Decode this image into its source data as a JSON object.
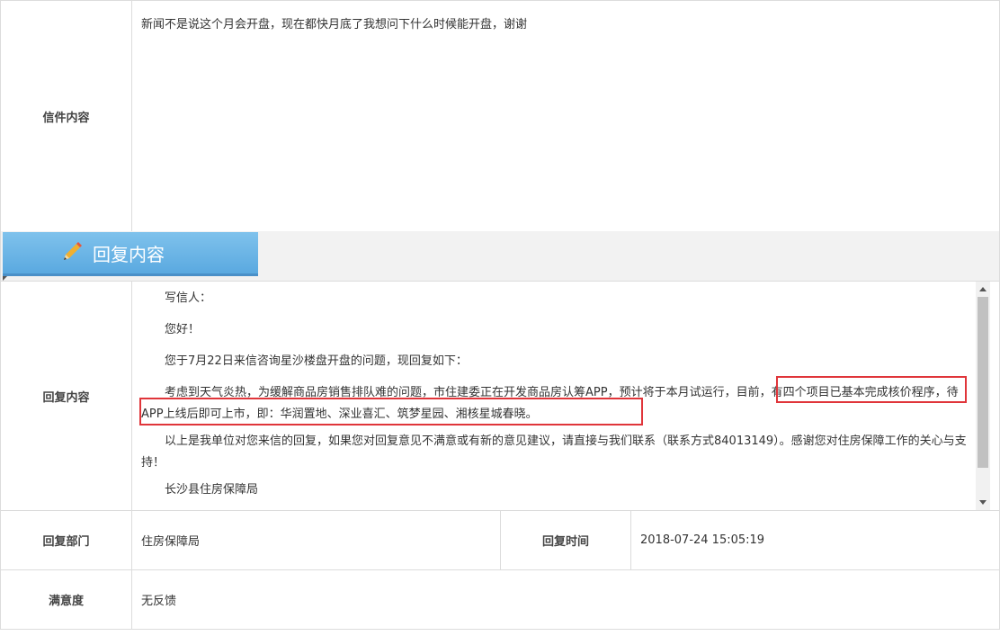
{
  "letter": {
    "label": "信件内容",
    "content": "新闻不是说这个月会开盘，现在都快月底了我想问下什么时候能开盘，谢谢"
  },
  "banner": {
    "title": "回复内容",
    "icon": "pencil-icon"
  },
  "reply": {
    "label": "回复内容",
    "paragraphs": [
      "写信人：",
      "您好！",
      "您于7月22日来信咨询星沙楼盘开盘的问题，现回复如下：",
      "考虑到天气炎热，为缓解商品房销售排队难的问题，市住建委正在开发商品房认筹APP，预计将于本月试运行，目前，有四个项目已基本完成核价程序，待APP上线后即可上市，即：华润置地、深业喜汇、筑梦星园、湘核星城春晓。",
      "以上是我单位对您来信的回复，如果您对回复意见不满意或有新的意见建议，请直接与我们联系（联系方式84013149）。感谢您对住房保障工作的关心与支持！",
      "长沙县住房保障局"
    ],
    "highlight_color": "#e0353a"
  },
  "meta": {
    "dept_label": "回复部门",
    "dept_value": "住房保障局",
    "time_label": "回复时间",
    "time_value": "2018-07-24 15:05:19",
    "satisfaction_label": "满意度",
    "satisfaction_value": "无反馈"
  },
  "colors": {
    "tab_blue": "#6db6e8",
    "border": "#dcdcdc"
  }
}
